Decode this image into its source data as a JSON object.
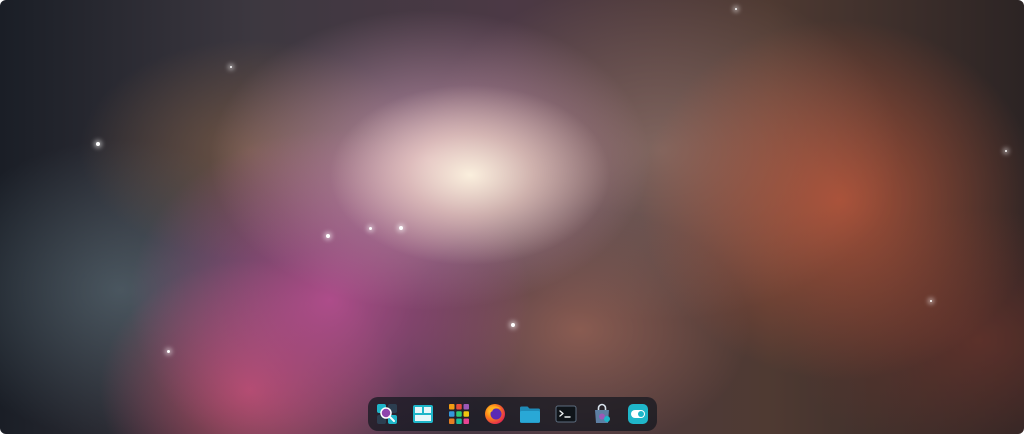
{
  "desktop": {
    "wallpaper": "orion-nebula-wallpaper"
  },
  "dock": {
    "items": [
      {
        "name": "app-launcher",
        "icon": "search-apps-icon"
      },
      {
        "name": "workspaces",
        "icon": "workspaces-icon"
      },
      {
        "name": "app-grid",
        "icon": "app-grid-icon"
      },
      {
        "name": "firefox",
        "icon": "firefox-icon"
      },
      {
        "name": "files",
        "icon": "folder-icon"
      },
      {
        "name": "terminal",
        "icon": "terminal-icon"
      },
      {
        "name": "store",
        "icon": "store-icon"
      },
      {
        "name": "settings",
        "icon": "toggle-icon"
      }
    ]
  },
  "colors": {
    "dock_background": "#12161e",
    "accent_teal": "#1fb6c9",
    "folder_blue": "#29a8d6"
  }
}
